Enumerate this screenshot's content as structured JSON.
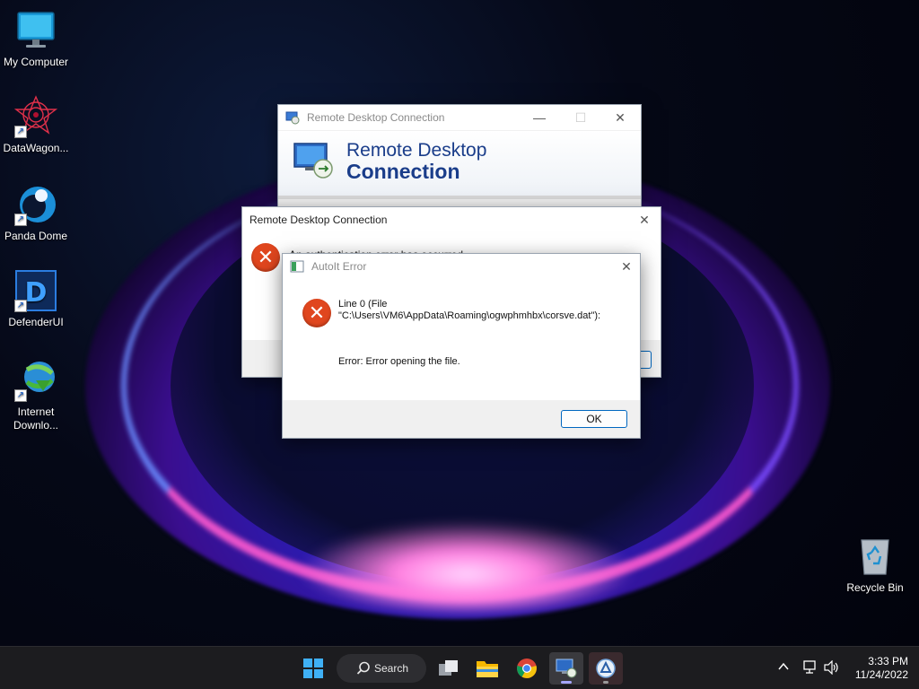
{
  "desktop": {
    "icons": [
      {
        "label": "My Computer",
        "icon": "monitor-icon"
      },
      {
        "label": "DataWagon...",
        "icon": "datawagon-icon"
      },
      {
        "label": "Panda Dome",
        "icon": "panda-dome-icon"
      },
      {
        "label": "DefenderUI",
        "icon": "defenderui-icon"
      },
      {
        "label": "Internet Downlo...",
        "icon": "internet-download-manager-icon"
      },
      {
        "label": "Recycle Bin",
        "icon": "recycle-bin-icon"
      }
    ]
  },
  "rdc_window": {
    "title": "Remote Desktop Connection",
    "banner_line1": "Remote Desktop",
    "banner_line2": "Connection"
  },
  "auth_dialog": {
    "title": "Remote Desktop Connection",
    "message": "An authentication error has occurred.",
    "partial_right_glyph": ")"
  },
  "autoit_dialog": {
    "title": "AutoIt Error",
    "line1": "Line 0  (File",
    "line2": "\"C:\\Users\\VM6\\AppData\\Roaming\\ogwphmhbx\\corsve.dat\"):",
    "error_text": "Error: Error opening the file.",
    "ok_label": "OK"
  },
  "taskbar": {
    "search_label": "Search",
    "time": "3:33 PM",
    "date": "11/24/2022"
  },
  "colors": {
    "error_red": "#e0461e",
    "accent_blue": "#0067c0",
    "taskbar_bg": "#1c1c1f"
  }
}
